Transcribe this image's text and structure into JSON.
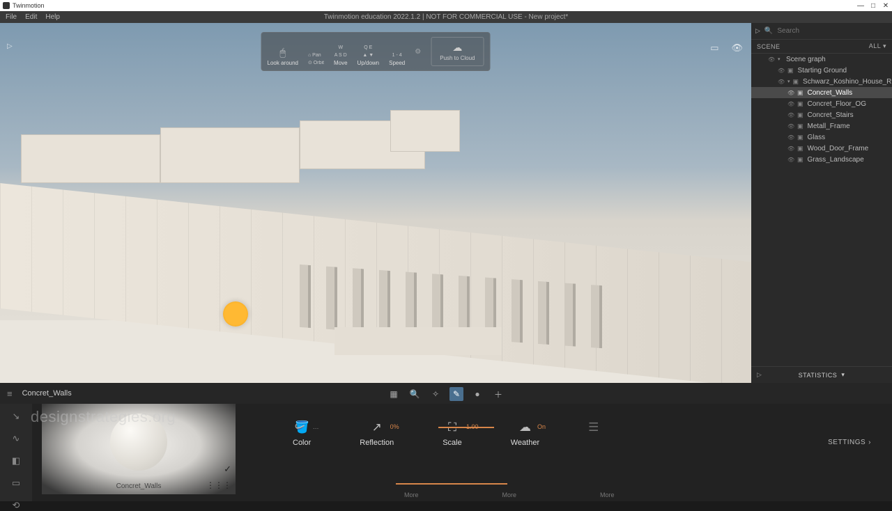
{
  "app": {
    "name": "Twinmotion"
  },
  "window": {
    "title": "Twinmotion education 2022.1.2 | NOT FOR COMMERCIAL USE - New project*"
  },
  "menu": {
    "file": "File",
    "edit": "Edit",
    "help": "Help"
  },
  "nav": {
    "lookaround": "Look around",
    "pan": "Pan",
    "orbit": "Orbit",
    "move": "Move",
    "updown": "Up/down",
    "speed": "Speed",
    "speed_keys": "1 - 4",
    "move_keys": "A S D",
    "move_keys2": "W",
    "updown_keys": "Q     E",
    "pushcloud": "Push to Cloud"
  },
  "search": {
    "placeholder": "Search"
  },
  "scene": {
    "header": "SCENE",
    "all": "ALL",
    "graph": "Scene graph",
    "items": [
      "Starting Ground",
      "Schwarz_Koshino_House_Rhinodatei",
      "Concret_Walls",
      "Concret_Floor_OG",
      "Concret_Stairs",
      "Metall_Frame",
      "Glass",
      "Wood_Door_Frame",
      "Grass_Landscape"
    ],
    "stats": "STATISTICS"
  },
  "bottom": {
    "title": "Concret_Walls",
    "material_name": "Concret_Walls",
    "props": {
      "color": "Color",
      "reflection": "Reflection",
      "reflection_val": "0%",
      "scale": "Scale",
      "scale_val": "1.00",
      "weather": "Weather",
      "weather_val": "On"
    },
    "more": "More",
    "settings": "SETTINGS"
  },
  "watermark": "designstrategies.org"
}
